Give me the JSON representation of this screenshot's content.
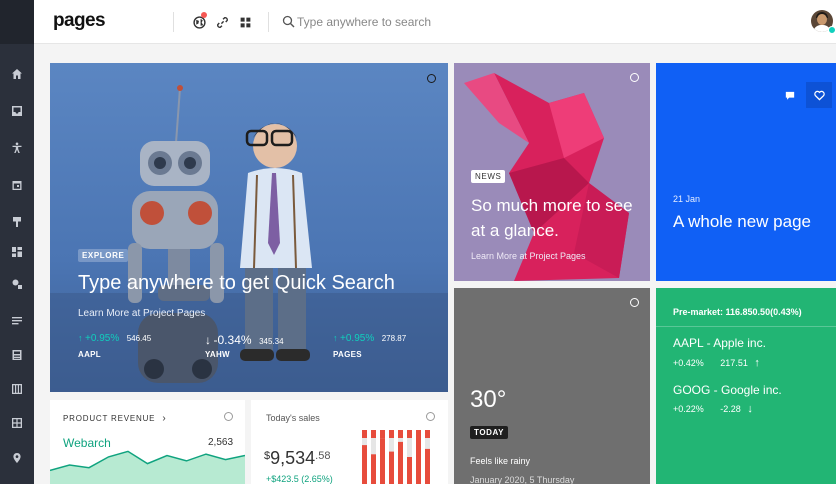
{
  "header": {
    "logo": "pages",
    "search_placeholder": "Type anywhere to search"
  },
  "sidebar": {
    "items": [
      {
        "icon": "home-icon"
      },
      {
        "icon": "inbox-icon"
      },
      {
        "icon": "accessibility-icon"
      },
      {
        "icon": "calendar-icon"
      },
      {
        "icon": "brush-icon"
      },
      {
        "icon": "layouts-icon"
      },
      {
        "icon": "social-icon"
      },
      {
        "icon": "forms-icon"
      },
      {
        "icon": "tables-icon"
      },
      {
        "icon": "maps-icon"
      },
      {
        "icon": "grid-icon"
      },
      {
        "icon": "location-icon"
      }
    ]
  },
  "explore": {
    "tag": "EXPLORE",
    "title": "Type anywhere to get Quick Search",
    "subtitle": "Learn More at Project Pages",
    "stocks": [
      {
        "change": "+0.95%",
        "value": "546.45",
        "symbol": "AAPL",
        "direction": "up"
      },
      {
        "change": "-0.34%",
        "value": "345.34",
        "symbol": "YAHW",
        "direction": "down"
      },
      {
        "change": "+0.95%",
        "value": "278.87",
        "symbol": "PAGES",
        "direction": "up"
      }
    ]
  },
  "news": {
    "tag": "NEWS",
    "title": "So much more to see at a glance.",
    "subtitle": "Learn More at Project Pages"
  },
  "blue_tile": {
    "date": "21 Jan",
    "title": "A whole new page"
  },
  "weather": {
    "temperature": "30°",
    "tag": "TODAY",
    "feels": "Feels like rainy",
    "date": "January 2020, 5 Thursday"
  },
  "premarket": {
    "title": "Pre-market: 116.850.50(0.43%)",
    "stocks": [
      {
        "name": "AAPL - Apple inc.",
        "change": "+0.42%",
        "value": "217.51",
        "direction": "up"
      },
      {
        "name": "GOOG - Google inc.",
        "change": "+0.22%",
        "value": "-2.28",
        "direction": "down"
      }
    ]
  },
  "revenue": {
    "label": "PRODUCT REVENUE",
    "series": "Webarch",
    "value": "2,563",
    "points": [
      10,
      14,
      12,
      20,
      24,
      15,
      21,
      17,
      22,
      18,
      21
    ]
  },
  "sales": {
    "label": "Today's sales",
    "currency": "$",
    "amount": "9,534",
    "cents": ".58",
    "change": "+$423.5 (2.65%)",
    "bars": [
      0.72,
      0.55,
      0.85,
      0.6,
      0.78,
      0.5,
      0.9,
      0.65
    ]
  },
  "colors": {
    "sidebar": "#2b303b",
    "blue": "#1060f5",
    "green": "#22b574",
    "teal": "#10cfbd",
    "bar_red": "#e74c3c"
  }
}
